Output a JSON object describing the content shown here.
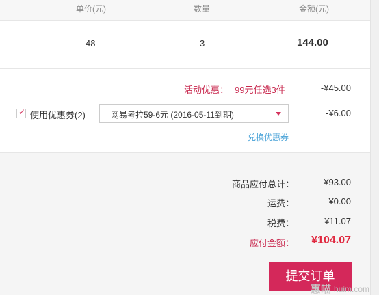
{
  "table_header": {
    "unit_price": "单价(元)",
    "quantity": "数量",
    "amount": "金额(元)"
  },
  "item": {
    "unit_price": "48",
    "quantity": "3",
    "amount": "144.00"
  },
  "promotion": {
    "label": "活动优惠：",
    "detail": "99元任选3件",
    "amount": "-¥45.00"
  },
  "coupon": {
    "checked": true,
    "check_glyph": "✓",
    "label": "使用优惠券(2)",
    "selected": "网易考拉59-6元 (2016-05-11到期)",
    "amount": "-¥6.00",
    "redeem_link": "兑换优惠券"
  },
  "summary": {
    "goods_total_label": "商品应付总计：",
    "goods_total_value": "¥93.00",
    "shipping_label": "运费：",
    "shipping_value": "¥0.00",
    "tax_label": "税费：",
    "tax_value": "¥11.07",
    "payable_label": "应付金额：",
    "payable_value": "¥104.07"
  },
  "submit_label": "提交订单",
  "watermark": {
    "logo": "惠喵",
    "url": "huim.com"
  },
  "colors": {
    "accent": "#d4285a",
    "price_red": "#e0283f",
    "promo_red": "#c8284e",
    "link_blue": "#4aa3d8"
  }
}
